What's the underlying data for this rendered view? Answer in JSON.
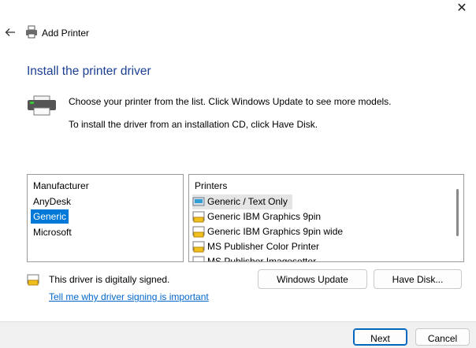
{
  "window": {
    "title": "Add Printer",
    "close_glyph": "✕"
  },
  "page": {
    "heading": "Install the printer driver",
    "desc_line1": "Choose your printer from the list. Click Windows Update to see more models.",
    "desc_line2": "To install the driver from an installation CD, click Have Disk."
  },
  "manufacturer_list": {
    "header": "Manufacturer",
    "items": [
      {
        "label": "AnyDesk",
        "selected": false
      },
      {
        "label": "Generic",
        "selected": true
      },
      {
        "label": "Microsoft",
        "selected": false
      }
    ]
  },
  "printers_list": {
    "header": "Printers",
    "items": [
      {
        "label": "Generic / Text Only",
        "selected": true
      },
      {
        "label": "Generic IBM Graphics 9pin",
        "selected": false
      },
      {
        "label": "Generic IBM Graphics 9pin wide",
        "selected": false
      },
      {
        "label": "MS Publisher Color Printer",
        "selected": false
      },
      {
        "label": "MS Publisher Imagesetter",
        "selected": false
      }
    ]
  },
  "signing": {
    "status": "This driver is digitally signed.",
    "link": "Tell me why driver signing is important"
  },
  "buttons": {
    "windows_update": "Windows Update",
    "have_disk": "Have Disk...",
    "next": "Next",
    "cancel": "Cancel"
  },
  "colors": {
    "accent": "#0078d7",
    "heading": "#1c3f94",
    "link": "#0066cc"
  }
}
